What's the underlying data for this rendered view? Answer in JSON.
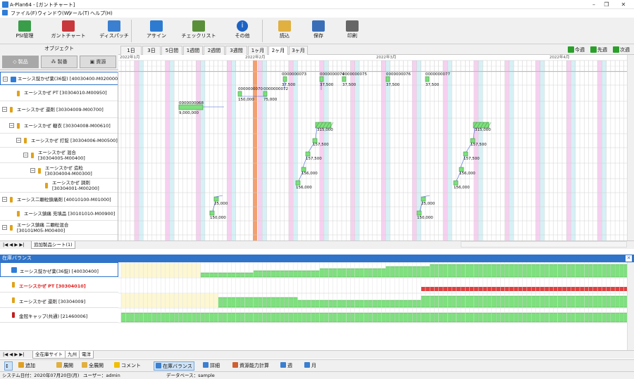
{
  "window": {
    "title": "A-Plan64 - [ガントチャート]"
  },
  "menu": [
    "ファイル(F)",
    "ウィンドウ(W)",
    "ツール(T)",
    "ヘルプ(H)"
  ],
  "toolbar": [
    {
      "label": "PSI管理",
      "icon": "psi-chart-icon",
      "color": "#3a9d4a"
    },
    {
      "label": "ガントチャート",
      "icon": "gantt-chart-icon",
      "color": "#c8373c"
    },
    {
      "label": "ディスパッチ",
      "icon": "dispatch-icon",
      "color": "#3a7fd0"
    },
    {
      "label": "アサイン",
      "icon": "assign-users-icon",
      "color": "#2c7bd0"
    },
    {
      "label": "チェックリスト",
      "icon": "checklist-icon",
      "color": "#5a8f3a"
    },
    {
      "label": "その他",
      "icon": "info-icon",
      "color": "#1e63c4"
    },
    {
      "label": "読込",
      "icon": "open-folder-icon",
      "color": "#e0b040"
    },
    {
      "label": "保存",
      "icon": "save-disk-icon",
      "color": "#3a6fb8"
    },
    {
      "label": "印刷",
      "icon": "printer-icon",
      "color": "#666666"
    }
  ],
  "object_panel": {
    "title": "オブジェクト",
    "tabs": [
      "製品",
      "製番",
      "資源"
    ]
  },
  "scale_tabs": [
    "1日",
    "3日",
    "5日間",
    "1週間",
    "2週間",
    "3週間",
    "1ヶ月",
    "2ヶ月",
    "3ヶ月"
  ],
  "active_scale": "2ヶ月",
  "nav": [
    "今週",
    "先週",
    "次週"
  ],
  "months": [
    "2022年1月",
    "2022年2月",
    "2022年3月",
    "2022年4月"
  ],
  "tree_items": [
    {
      "text": "エーシス錠かぜ薬(36錠) [40030400-M020000]",
      "level": 0,
      "type": "box",
      "expand": "-",
      "selected": true
    },
    {
      "text": "エーシスかぜ PT [30304010-M00950]",
      "level": 1,
      "type": "bottle"
    },
    {
      "text": "エーシスかぜ 還剤 [30304009-M00700]",
      "level": 0,
      "type": "bottle",
      "expand": "-"
    },
    {
      "text": "エーシスかぜ 糖衣 [30304008-M00610]",
      "level": 1,
      "type": "bottle",
      "expand": "-"
    },
    {
      "text": "エーシスかぜ 打錠 [30304006-M00500]",
      "level": 2,
      "type": "bottle",
      "expand": "-"
    },
    {
      "text": "エーシスかぜ 混合",
      "text2": "[30304005-M00400]",
      "level": 3,
      "type": "bottle",
      "expand": "-"
    },
    {
      "text": "エーシスかぜ 造粒",
      "text2": "[30304004-M00300]",
      "level": 4,
      "type": "bottle",
      "expand": "-"
    },
    {
      "text": "エーシスかぜ 調剤",
      "text2": "[30304001-M00200]",
      "level": 5,
      "type": "bottle"
    },
    {
      "text": "エーシス二顆粒鎮痛剤 [40010100-M01000]",
      "level": 0,
      "type": "bottle",
      "expand": "-"
    },
    {
      "text": "エーシス鎮痛 充填品 [30101010-M00900]",
      "level": 1,
      "type": "bottle"
    },
    {
      "text": "エーシス鎮痛 二顆粒混合",
      "text2": "[30101M05-M00400]",
      "level": 0,
      "type": "bottle",
      "expand": "-"
    }
  ],
  "gantt_labels": [
    {
      "text": "0000000073",
      "row": 0
    },
    {
      "text": "0000000074",
      "row": 0
    },
    {
      "text": "0000000075",
      "row": 0
    },
    {
      "text": "0000000076",
      "row": 0
    },
    {
      "text": "0000000077",
      "row": 0
    },
    {
      "text": "37,500",
      "row": 0
    },
    {
      "text": "37,500",
      "row": 0
    },
    {
      "text": "37,500",
      "row": 0
    },
    {
      "text": "37,500",
      "row": 0
    },
    {
      "text": "37,500",
      "row": 0
    },
    {
      "text": "0000000070",
      "row": 1
    },
    {
      "text": "0000000072",
      "row": 1
    },
    {
      "text": "150,000",
      "row": 1
    },
    {
      "text": "75,000",
      "row": 1
    },
    {
      "text": "0000000068",
      "row": 2
    },
    {
      "text": "9,000,000",
      "row": 2
    },
    {
      "text": "315,000",
      "row": 3
    },
    {
      "text": "315,000",
      "row": 3
    },
    {
      "text": "157,500",
      "row": 4
    },
    {
      "text": "157,500",
      "row": 4
    },
    {
      "text": "157,500",
      "row": 5
    },
    {
      "text": "157,500",
      "row": 5
    },
    {
      "text": "156,000",
      "row": 6
    },
    {
      "text": "156,000",
      "row": 6
    },
    {
      "text": "156,000",
      "row": 7
    },
    {
      "text": "156,000",
      "row": 7
    },
    {
      "text": "25,000",
      "row": 8
    },
    {
      "text": "25,000",
      "row": 8
    },
    {
      "text": "150,000",
      "row": 9
    },
    {
      "text": "150,000",
      "row": 9
    }
  ],
  "sheet_tab": "追加製品シート(1)",
  "stock_balance": {
    "title": "在庫バランス",
    "rows": [
      {
        "text": "エーシス錠かぜ薬(36錠) [40030400]",
        "type": "box",
        "selected": true,
        "color": "#111111"
      },
      {
        "text": "エーシスかぜ PT [30304010]",
        "type": "bottle",
        "color": "#e02020"
      },
      {
        "text": "エーシスかぜ 還剤 [30304009]",
        "type": "bottle",
        "color": "#111111"
      },
      {
        "text": "金冠キャップ(共通) [21460006]",
        "type": "cap",
        "color": "#111111"
      }
    ],
    "sheet_tabs": [
      "全在庫サイト",
      "九州",
      "電洋"
    ]
  },
  "bottom_toolbar": [
    "追加",
    "展開",
    "全展開",
    "コメント",
    "在庫バランス",
    "詳細",
    "資源能力計算",
    "週",
    "月"
  ],
  "active_bottom": "在庫バランス",
  "status": {
    "date": "システム日付：2020年07月20日(月)",
    "user": "ユーザー：admin",
    "db": "データベース：sample"
  }
}
